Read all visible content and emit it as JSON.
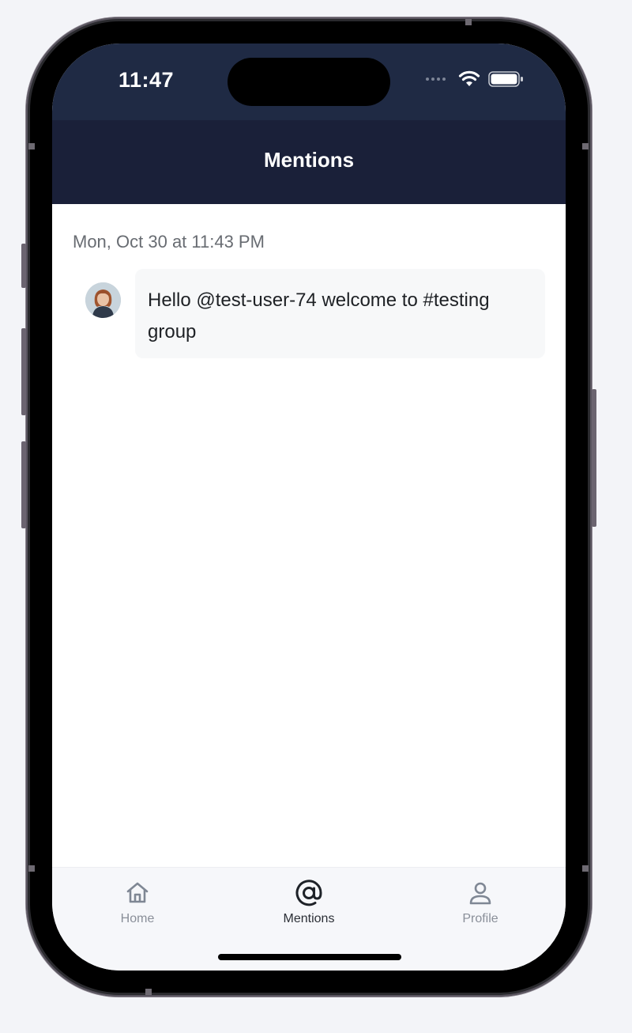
{
  "status_bar": {
    "time": "11:47",
    "icons": [
      "signal-dots-icon",
      "wifi-icon",
      "battery-icon"
    ]
  },
  "nav": {
    "title": "Mentions"
  },
  "mentions": {
    "items": [
      {
        "date": "Mon, Oct 30 at 11:43 PM",
        "avatar": "user-avatar",
        "message": "Hello @test-user-74 welcome to #testing group"
      }
    ]
  },
  "tab_bar": {
    "tabs": [
      {
        "label": "Home",
        "icon": "home-icon",
        "active": false
      },
      {
        "label": "Mentions",
        "icon": "at-sign-icon",
        "active": true
      },
      {
        "label": "Profile",
        "icon": "person-icon",
        "active": false
      }
    ]
  },
  "colors": {
    "header_bg": "#1a2039",
    "status_bg": "#1f2a44",
    "active_tab": "#2b2f36",
    "inactive_tab": "#8a8f99"
  }
}
